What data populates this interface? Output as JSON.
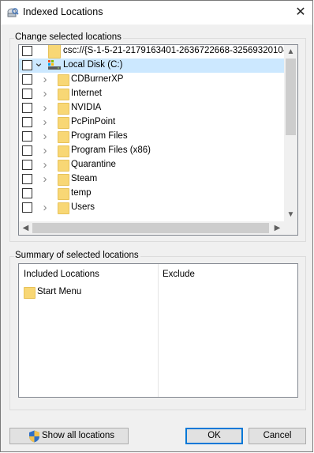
{
  "window": {
    "title": "Indexed Locations",
    "close_glyph": "✕",
    "icon": "indexing-options-icon"
  },
  "locations_group": {
    "label": "Change selected locations",
    "rows": [
      {
        "label": "csc://{S-1-5-21-2179163401-2636722668-3256932010-1",
        "checked": false,
        "expander": "",
        "icon": "folder-icon",
        "level": 0
      },
      {
        "label": "Local Disk (C:)",
        "checked": false,
        "expander": "v",
        "icon": "drive-icon",
        "level": 0,
        "selected": true
      },
      {
        "label": "CDBurnerXP",
        "checked": false,
        "expander": ">",
        "icon": "folder-icon",
        "level": 1
      },
      {
        "label": "Internet",
        "checked": false,
        "expander": ">",
        "icon": "folder-icon",
        "level": 1
      },
      {
        "label": "NVIDIA",
        "checked": false,
        "expander": ">",
        "icon": "folder-icon",
        "level": 1
      },
      {
        "label": "PcPinPoint",
        "checked": false,
        "expander": ">",
        "icon": "folder-icon",
        "level": 1
      },
      {
        "label": "Program Files",
        "checked": false,
        "expander": ">",
        "icon": "folder-icon",
        "level": 1
      },
      {
        "label": "Program Files (x86)",
        "checked": false,
        "expander": ">",
        "icon": "folder-icon",
        "level": 1
      },
      {
        "label": "Quarantine",
        "checked": false,
        "expander": ">",
        "icon": "folder-icon",
        "level": 1
      },
      {
        "label": "Steam",
        "checked": false,
        "expander": ">",
        "icon": "folder-icon",
        "level": 1
      },
      {
        "label": "temp",
        "checked": false,
        "expander": "",
        "icon": "folder-icon",
        "level": 1
      },
      {
        "label": "Users",
        "checked": false,
        "expander": ">",
        "icon": "folder-icon",
        "level": 1
      }
    ]
  },
  "summary_group": {
    "label": "Summary of selected locations",
    "included_header": "Included Locations",
    "exclude_header": "Exclude",
    "included": [
      {
        "label": "Start Menu",
        "icon": "folder-icon"
      }
    ]
  },
  "buttons": {
    "show_all": "Show all locations",
    "ok": "OK",
    "cancel": "Cancel"
  },
  "colors": {
    "selection": "#cce8ff",
    "folder": "#f8d775",
    "default_button_border": "#0078d7"
  }
}
